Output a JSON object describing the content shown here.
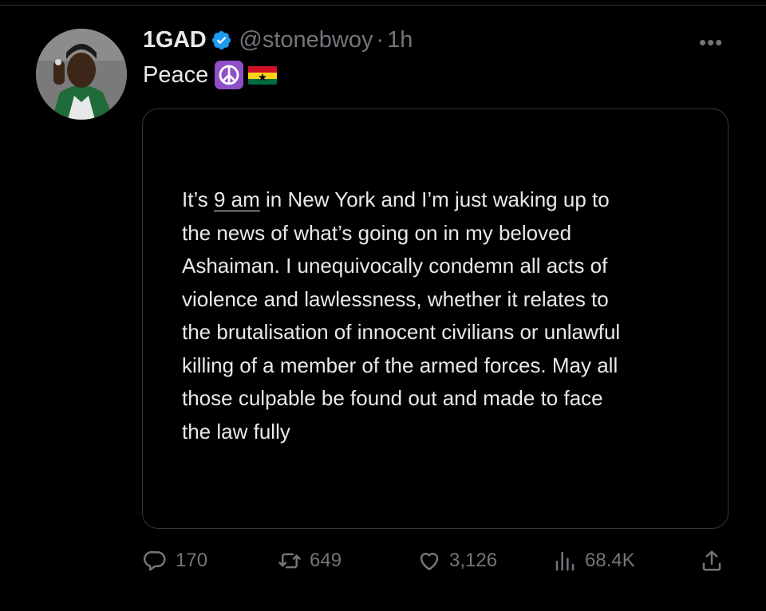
{
  "tweet": {
    "display_name": "1GAD",
    "handle": "@stonebwoy",
    "separator": "·",
    "time": "1h",
    "text": "Peace",
    "emoji": [
      "peace-symbol",
      "ghana-flag"
    ],
    "card": {
      "lines": [
        {
          "before": "It’s ",
          "underlined": "9 am",
          "after": " in New York and I’m just waking up to"
        },
        {
          "text": "the news of what’s going on in my beloved"
        },
        {
          "text": "Ashaiman. I unequivocally condemn all acts of"
        },
        {
          "text": "violence and lawlessness, whether it relates to"
        },
        {
          "text": "the brutalisation of innocent civilians or unlawful"
        },
        {
          "text": "killing of a member of the armed forces. May all"
        },
        {
          "text": "those culpable be found out and made to face"
        },
        {
          "text": "the law fully"
        }
      ]
    },
    "stats": {
      "replies": "170",
      "retweets": "649",
      "likes": "3,126",
      "views": "68.4K"
    }
  },
  "colors": {
    "background": "#000000",
    "text": "#e7e9ea",
    "muted": "#71767b",
    "verified": "#1d9bf0",
    "border": "#333639"
  }
}
